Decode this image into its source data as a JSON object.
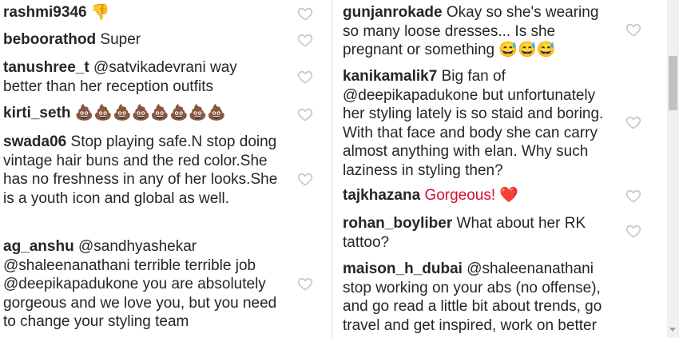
{
  "left_comments": [
    {
      "user": "rashmi9346",
      "text": "👎"
    },
    {
      "user": "beboorathod",
      "text": "Super"
    },
    {
      "user": "tanushree_t",
      "text": "@satvikadevrani way better than her reception outfits"
    },
    {
      "user": "kirti_seth",
      "text": "💩💩💩💩💩💩💩💩"
    },
    {
      "user": "swada06",
      "text": "Stop playing safe.N stop doing vintage hair buns and the red color.She has no freshness in any of her looks.She is a youth icon and global as well."
    },
    {
      "user": "ag_anshu",
      "text": "@sandhyashekar @shaleenanathani terrible terrible job @deepikapadukone you are absolutely gorgeous and we love you, but you need to change your styling team"
    }
  ],
  "right_comments": [
    {
      "user": "gunjanrokade",
      "text": "Okay so she's wearing so many loose dresses... Is she pregnant or something 😅😅😅"
    },
    {
      "user": "kanikamalik7",
      "text": "Big fan of @deepikapadukone but unfortunately her styling lately is so staid and boring. With that face and body she can carry almost anything with elan. Why such laziness in styling then?"
    },
    {
      "user": "tajkhazana",
      "text": "Gorgeous! ❤️"
    },
    {
      "user": "rohan_boyliber",
      "text": "What about her RK tattoo?"
    },
    {
      "user": "maison_h_dubai",
      "text": "@shaleenanathani stop working on your abs (no offense), and go read a little bit about trends, go travel and get inspired, work on better"
    }
  ],
  "icons": {
    "like": "heart-outline-icon"
  },
  "colors": {
    "text": "#262626",
    "heart": "#c7c7c7",
    "divider": "#dbdbdb"
  }
}
